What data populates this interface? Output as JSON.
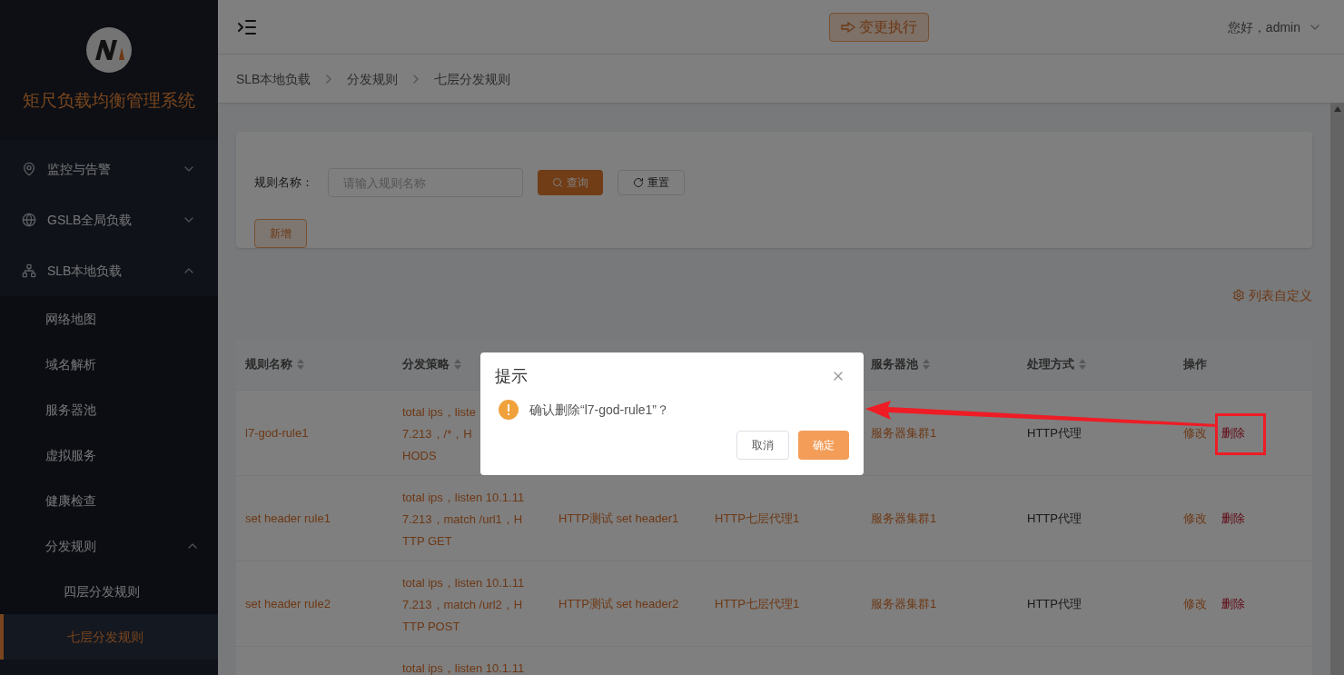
{
  "sidebar": {
    "title": "矩尺负载均衡管理系统",
    "items": [
      {
        "label": "监控与告警",
        "expanded": false
      },
      {
        "label": "GSLB全局负载",
        "expanded": false
      },
      {
        "label": "SLB本地负载",
        "expanded": true,
        "children": [
          {
            "label": "网络地图",
            "selected": false
          },
          {
            "label": "域名解析",
            "selected": false
          },
          {
            "label": "服务器池",
            "selected": false
          },
          {
            "label": "虚拟服务",
            "selected": false
          },
          {
            "label": "健康检查",
            "selected": false
          },
          {
            "label": "分发规则",
            "expanded": true,
            "children": [
              {
                "label": "四层分发规则",
                "selected": false
              },
              {
                "label": "七层分发规则",
                "selected": true
              }
            ]
          }
        ]
      }
    ]
  },
  "header": {
    "action_button": "变更执行",
    "user": "您好，admin"
  },
  "breadcrumb": [
    "SLB本地负载",
    "分发规则",
    "七层分发规则"
  ],
  "search": {
    "label": "规则名称：",
    "placeholder": "请输入规则名称",
    "query_button": "查询",
    "reset_button": "重置",
    "add_button": "新增"
  },
  "list_settings": "列表自定义",
  "table": {
    "columns": [
      {
        "label": "规则名称",
        "sortable": true
      },
      {
        "label": "分发策略",
        "sortable": true
      },
      {
        "label": "服务器池",
        "sortable": true
      },
      {
        "label": "处理方式",
        "sortable": true
      },
      {
        "label": "操作",
        "sortable": false
      }
    ],
    "rows": [
      {
        "name": "l7-god-rule1",
        "strategy": [
          "total ips，liste",
          "7.213，/*，H",
          "HODS"
        ],
        "pool": "服务器集群1",
        "method": "HTTP代理",
        "actions": [
          "修改",
          "删除"
        ]
      },
      {
        "name": "set header rule1",
        "strategy": [
          "total ips，listen 10.1.11",
          "7.213，match /url1，H",
          "TTP GET"
        ],
        "column_3": "HTTP测试 set header1",
        "column_4": "HTTP七层代理1",
        "pool": "服务器集群1",
        "method": "HTTP代理",
        "actions": [
          "修改",
          "删除"
        ]
      },
      {
        "name": "set header rule2",
        "strategy": [
          "total ips，listen 10.1.11",
          "7.213，match /url2，H",
          "TTP POST"
        ],
        "column_3": "HTTP测试 set header2",
        "column_4": "HTTP七层代理1",
        "pool": "服务器集群1",
        "method": "HTTP代理",
        "actions": [
          "修改",
          "删除"
        ]
      },
      {
        "strategy": [
          "total ips，listen 10.1.11"
        ]
      }
    ]
  },
  "dialog": {
    "title": "提示",
    "message": "确认删除“l7-god-rule1”？",
    "cancel": "取消",
    "confirm": "确定"
  }
}
